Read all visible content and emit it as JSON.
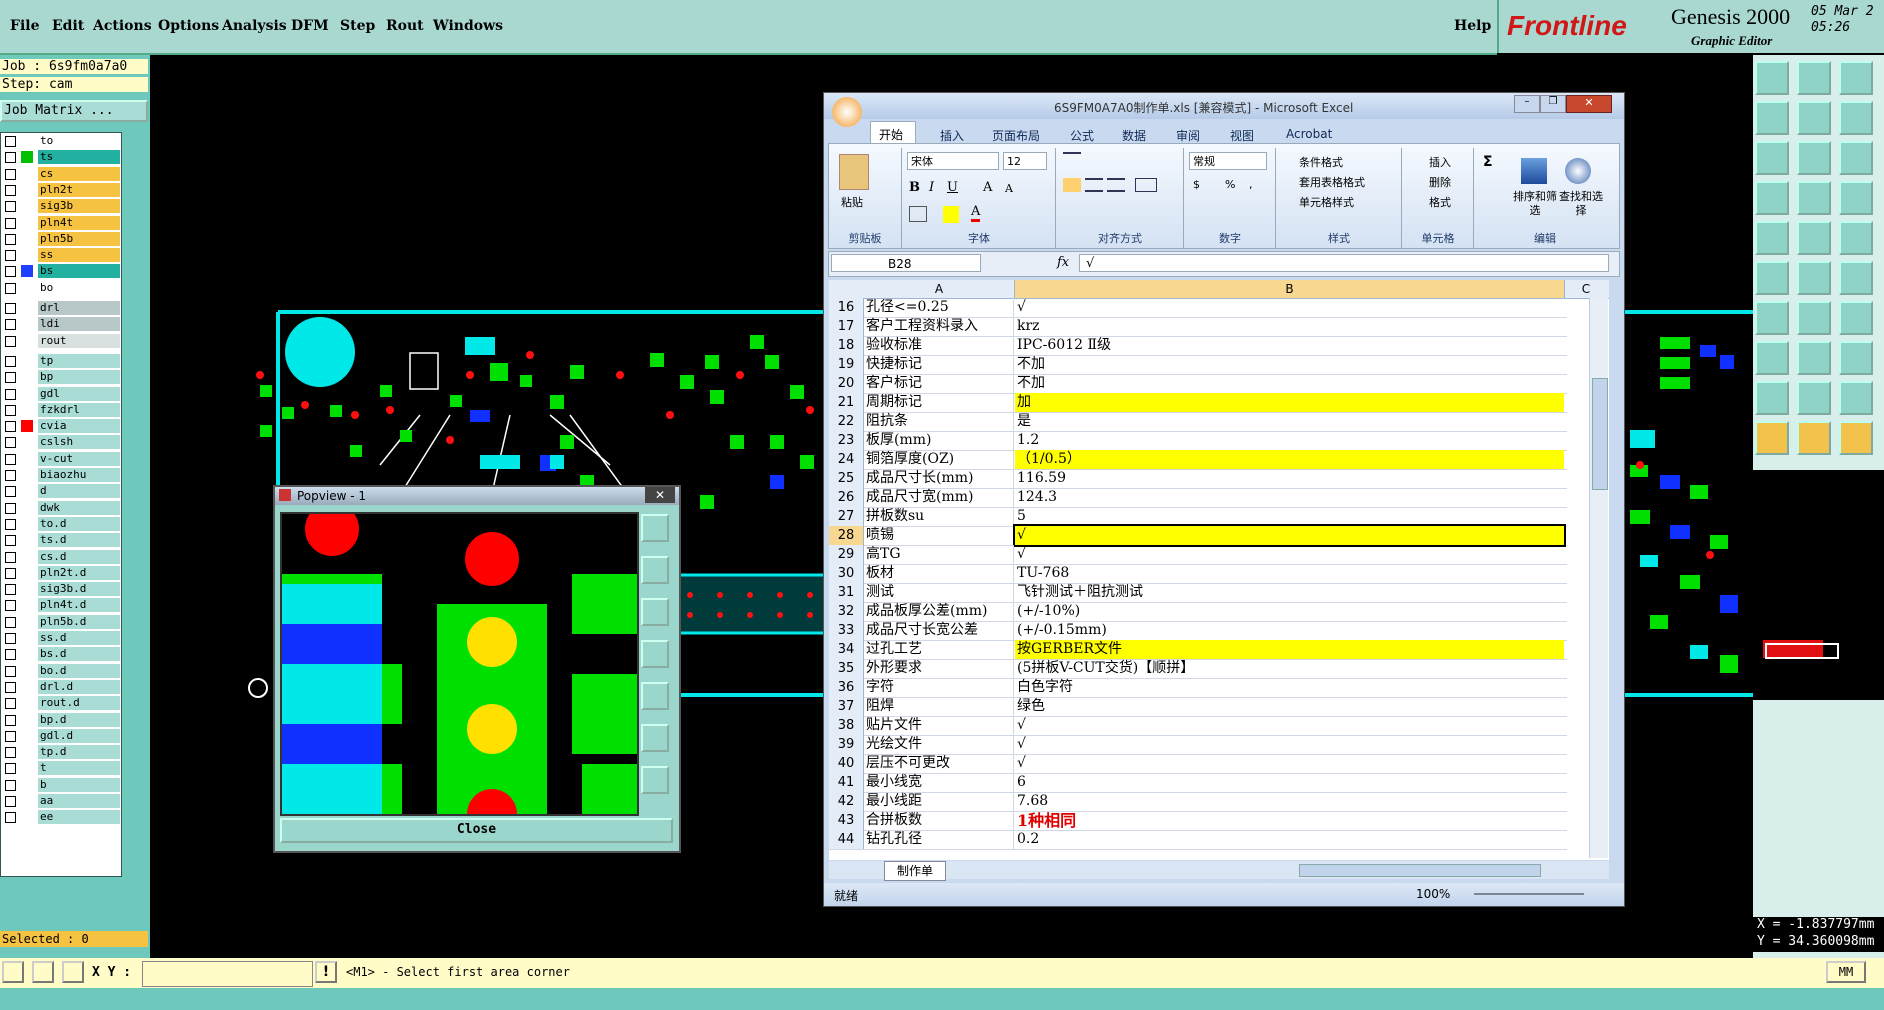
{
  "menubar": {
    "items": [
      "File",
      "Edit",
      "Actions",
      "Options",
      "Analysis",
      "DFM",
      "Step",
      "Rout",
      "Windows"
    ],
    "help": "Help"
  },
  "logo": {
    "brand": "Frontline",
    "product": "Genesis 2000",
    "subtitle": "Graphic Editor",
    "date": "05 Mar 2",
    "time": "05:26"
  },
  "job": {
    "job_label": "Job : 6s9fm0a7a0",
    "step_label": "Step: cam",
    "matrix_button": "Job Matrix ..."
  },
  "layers": [
    {
      "name": "to",
      "bg": "#ffffff",
      "sw": "#ffffff"
    },
    {
      "name": "ts",
      "bg": "#22b0a0",
      "sw": "#00c000"
    },
    {
      "name": "cs",
      "bg": "#f5c242",
      "sw": "#ffffff"
    },
    {
      "name": "pln2t",
      "bg": "#f5c242",
      "sw": "#ffffff"
    },
    {
      "name": "sig3b",
      "bg": "#f5c242",
      "sw": "#ffffff"
    },
    {
      "name": "pln4t",
      "bg": "#f5c242",
      "sw": "#ffffff"
    },
    {
      "name": "pln5b",
      "bg": "#f5c242",
      "sw": "#ffffff"
    },
    {
      "name": "ss",
      "bg": "#f5c242",
      "sw": "#ffffff"
    },
    {
      "name": "bs",
      "bg": "#22b0a0",
      "sw": "#2040ff"
    },
    {
      "name": "bo",
      "bg": "#ffffff",
      "sw": "#ffffff"
    },
    {
      "name": "drl",
      "bg": "#b8c8c8",
      "sw": "#ffffff"
    },
    {
      "name": "ldi",
      "bg": "#b8c8c8",
      "sw": "#ffffff"
    },
    {
      "name": "rout",
      "bg": "#d8e0e0",
      "sw": "#ffffff"
    },
    {
      "name": "tp",
      "bg": "#a8dcd4",
      "sw": "#ffffff"
    },
    {
      "name": "bp",
      "bg": "#a8dcd4",
      "sw": "#ffffff"
    },
    {
      "name": "gdl",
      "bg": "#a8dcd4",
      "sw": "#ffffff"
    },
    {
      "name": "fzkdrl",
      "bg": "#a8dcd4",
      "sw": "#ffffff"
    },
    {
      "name": "cvia",
      "bg": "#a8dcd4",
      "sw": "#ff0000"
    },
    {
      "name": "cslsh",
      "bg": "#a8dcd4",
      "sw": "#ffffff"
    },
    {
      "name": "v-cut",
      "bg": "#a8dcd4",
      "sw": "#ffffff"
    },
    {
      "name": "biaozhu",
      "bg": "#a8dcd4",
      "sw": "#ffffff"
    },
    {
      "name": "d",
      "bg": "#a8dcd4",
      "sw": "#ffffff"
    },
    {
      "name": "dwk",
      "bg": "#a8dcd4",
      "sw": "#ffffff"
    },
    {
      "name": "to.d",
      "bg": "#a8dcd4",
      "sw": "#ffffff"
    },
    {
      "name": "ts.d",
      "bg": "#a8dcd4",
      "sw": "#ffffff"
    },
    {
      "name": "cs.d",
      "bg": "#a8dcd4",
      "sw": "#ffffff"
    },
    {
      "name": "pln2t.d",
      "bg": "#a8dcd4",
      "sw": "#ffffff"
    },
    {
      "name": "sig3b.d",
      "bg": "#a8dcd4",
      "sw": "#ffffff"
    },
    {
      "name": "pln4t.d",
      "bg": "#a8dcd4",
      "sw": "#ffffff"
    },
    {
      "name": "pln5b.d",
      "bg": "#a8dcd4",
      "sw": "#ffffff"
    },
    {
      "name": "ss.d",
      "bg": "#a8dcd4",
      "sw": "#ffffff"
    },
    {
      "name": "bs.d",
      "bg": "#a8dcd4",
      "sw": "#ffffff"
    },
    {
      "name": "bo.d",
      "bg": "#a8dcd4",
      "sw": "#ffffff"
    },
    {
      "name": "drl.d",
      "bg": "#a8dcd4",
      "sw": "#ffffff"
    },
    {
      "name": "rout.d",
      "bg": "#a8dcd4",
      "sw": "#ffffff"
    },
    {
      "name": "bp.d",
      "bg": "#a8dcd4",
      "sw": "#ffffff"
    },
    {
      "name": "gdl.d",
      "bg": "#a8dcd4",
      "sw": "#ffffff"
    },
    {
      "name": "tp.d",
      "bg": "#a8dcd4",
      "sw": "#ffffff"
    },
    {
      "name": "t",
      "bg": "#a8dcd4",
      "sw": "#ffffff"
    },
    {
      "name": "b",
      "bg": "#a8dcd4",
      "sw": "#ffffff"
    },
    {
      "name": "aa",
      "bg": "#a8dcd4",
      "sw": "#ffffff"
    },
    {
      "name": "ee",
      "bg": "#a8dcd4",
      "sw": "#ffffff"
    }
  ],
  "selected": "Selected : 0",
  "status": {
    "xy_label": "X Y :",
    "prompt": "<M1> - Select first area corner",
    "units": "MM"
  },
  "coords": {
    "x": "X = -1.837797mm",
    "y": "Y = 34.360098mm"
  },
  "popview": {
    "title": "Popview - 1",
    "close": "Close"
  },
  "excel": {
    "title": "6S9FM0A7A0制作单.xls [兼容模式] - Microsoft Excel",
    "tabs": [
      "开始",
      "插入",
      "页面布局",
      "公式",
      "数据",
      "审阅",
      "视图",
      "Acrobat"
    ],
    "font": "宋体",
    "font_size": "12",
    "number_format": "常规",
    "groups": [
      "剪贴板",
      "字体",
      "对齐方式",
      "数字",
      "样式",
      "单元格",
      "编辑"
    ],
    "paste": "粘贴",
    "styles": [
      "条件格式",
      "套用表格格式",
      "单元格样式"
    ],
    "cells_cmds": [
      "插入",
      "删除",
      "格式"
    ],
    "edit_cmds": [
      "排序和筛选",
      "查找和选择"
    ],
    "name_box": "B28",
    "formula": "√",
    "col_a": "A",
    "col_b": "B",
    "col_c": "C",
    "sheet_tab": "制作单",
    "status_ready": "就绪",
    "zoom": "100%",
    "rows": [
      {
        "n": "16",
        "a": "孔径<=0.25",
        "b": "√",
        "hl": false
      },
      {
        "n": "17",
        "a": "客户工程资料录入",
        "b": "krz",
        "hl": false
      },
      {
        "n": "18",
        "a": "验收标准",
        "b": "IPC-6012 Ⅱ级",
        "hl": false
      },
      {
        "n": "19",
        "a": "快捷标记",
        "b": "不加",
        "hl": false
      },
      {
        "n": "20",
        "a": "客户标记",
        "b": "不加",
        "hl": false
      },
      {
        "n": "21",
        "a": "周期标记",
        "b": "加",
        "hl": true
      },
      {
        "n": "22",
        "a": "阻抗条",
        "b": "是",
        "hl": false
      },
      {
        "n": "23",
        "a": "板厚(mm)",
        "b": "1.2",
        "hl": false
      },
      {
        "n": "24",
        "a": "铜箔厚度(OZ)",
        "b": "（1/0.5）",
        "hl": true
      },
      {
        "n": "25",
        "a": "成品尺寸长(mm)",
        "b": "116.59",
        "hl": false
      },
      {
        "n": "26",
        "a": "成品尺寸宽(mm)",
        "b": "124.3",
        "hl": false
      },
      {
        "n": "27",
        "a": "拼板数su",
        "b": "5",
        "hl": false
      },
      {
        "n": "28",
        "a": "喷锡",
        "b": "√",
        "hl": true
      },
      {
        "n": "29",
        "a": "高TG",
        "b": "√",
        "hl": false
      },
      {
        "n": "30",
        "a": "板材",
        "b": "TU-768",
        "hl": false
      },
      {
        "n": "31",
        "a": "测试",
        "b": "飞针测试＋阻抗测试",
        "hl": false
      },
      {
        "n": "32",
        "a": "成品板厚公差(mm)",
        "b": "(+/-10%)",
        "hl": false
      },
      {
        "n": "33",
        "a": "成品尺寸长宽公差",
        "b": "(+/-0.15mm)",
        "hl": false
      },
      {
        "n": "34",
        "a": "过孔工艺",
        "b": "按GERBER文件",
        "hl": true
      },
      {
        "n": "35",
        "a": "外形要求",
        "b": "(5拼板V-CUT交货)【顺拼】",
        "hl": false
      },
      {
        "n": "36",
        "a": "字符",
        "b": "白色字符",
        "hl": false
      },
      {
        "n": "37",
        "a": "阻焊",
        "b": "绿色",
        "hl": false
      },
      {
        "n": "38",
        "a": "贴片文件",
        "b": "√",
        "hl": false
      },
      {
        "n": "39",
        "a": "光绘文件",
        "b": "√",
        "hl": false
      },
      {
        "n": "40",
        "a": "层压不可更改",
        "b": "√",
        "hl": false
      },
      {
        "n": "41",
        "a": "最小线宽",
        "b": "6",
        "hl": false
      },
      {
        "n": "42",
        "a": "最小线距",
        "b": "7.68",
        "hl": false
      },
      {
        "n": "43",
        "a": "合拼板数",
        "b": "1种相同",
        "hl": false,
        "red": true
      },
      {
        "n": "44",
        "a": "钻孔孔径",
        "b": "0.2",
        "hl": false
      }
    ]
  },
  "colors": {
    "ui_teal": "#6ec8bc",
    "pcb_green": "#00e000",
    "pcb_cyan": "#00e8e8",
    "pcb_red": "#ff0000",
    "pcb_blue": "#1030ff",
    "excel_blue": "#c9daf0"
  }
}
